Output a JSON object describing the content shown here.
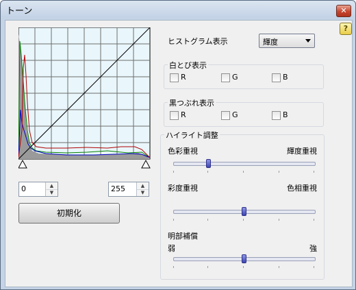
{
  "window": {
    "title": "トーン",
    "close_glyph": "✕",
    "help_glyph": "?"
  },
  "histogram": {
    "source_select_label": "ヒストグラム表示",
    "source_value": "輝度",
    "input_min": "0",
    "input_max": "255",
    "reset_button": "初期化"
  },
  "highlight_clip": {
    "title": "白とび表示",
    "checkboxes": [
      {
        "label": "R",
        "checked": false
      },
      {
        "label": "G",
        "checked": false
      },
      {
        "label": "B",
        "checked": false
      }
    ]
  },
  "shadow_clip": {
    "title": "黒つぶれ表示",
    "checkboxes": [
      {
        "label": "R",
        "checked": false
      },
      {
        "label": "G",
        "checked": false
      },
      {
        "label": "B",
        "checked": false
      }
    ]
  },
  "highlight_adjust": {
    "title": "ハイライト調整",
    "sliders": [
      {
        "left_label": "色彩重視",
        "right_label": "輝度重視",
        "value": 0.25
      },
      {
        "left_label": "彩度重視",
        "right_label": "色相重視",
        "value": 0.5
      },
      {
        "left_label": "弱",
        "right_label": "強",
        "value": 0.5
      }
    ],
    "third_label": "明部補償"
  },
  "colors": {
    "red_curve": "#b00000",
    "green_curve": "#008000",
    "blue_curve": "#0000c0",
    "gray_fill": "#9a9a9a"
  }
}
